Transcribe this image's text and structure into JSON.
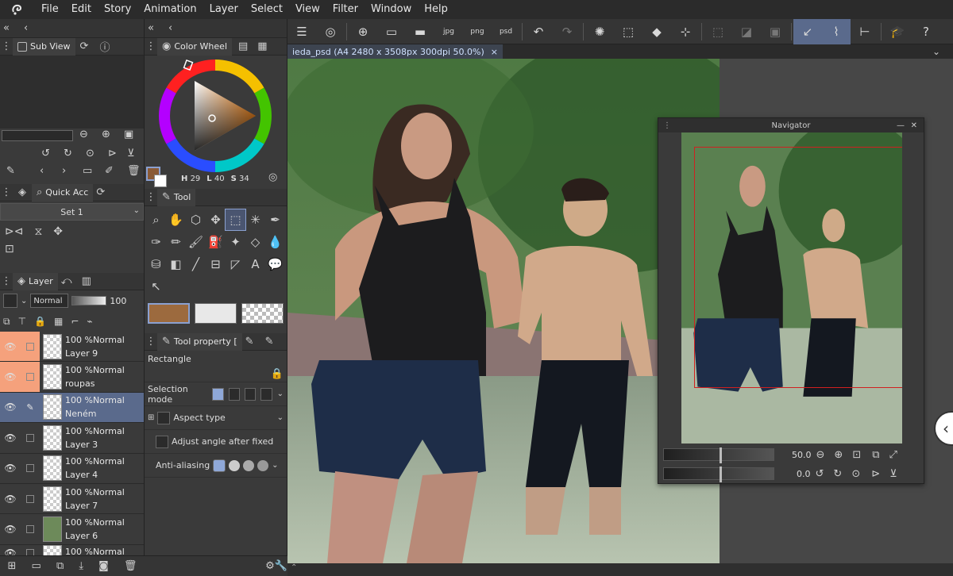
{
  "menu": {
    "items": [
      "File",
      "Edit",
      "Story",
      "Animation",
      "Layer",
      "Select",
      "View",
      "Filter",
      "Window",
      "Help"
    ]
  },
  "subview": {
    "tab_label": "Sub View"
  },
  "quickaccess": {
    "tab_label": "Quick Acc",
    "set_label": "Set 1"
  },
  "colorwheel": {
    "tab_label": "Color Wheel",
    "h_label": "H",
    "h_value": "29",
    "l_label": "L",
    "l_value": "40",
    "s_label": "S",
    "s_value": "34",
    "main_color": "#8a5a36",
    "sub_color": "#ffffff"
  },
  "tool": {
    "tab_label": "Tool"
  },
  "toolproperty": {
    "tab_label": "Tool property [",
    "tool_name": "Rectangle",
    "selection_mode_label": "Selection mode",
    "aspect_type_label": "Aspect type",
    "adjust_angle_label": "Adjust angle after fixed",
    "antialiasing_label": "Anti-aliasing"
  },
  "swatches": {
    "main": "#9c6a3e",
    "sub": "#e8e8e8"
  },
  "layer": {
    "tab_label": "Layer",
    "blend_mode": "Normal",
    "opacity": "100",
    "layers": [
      {
        "opacity": "100 %",
        "mode": "Normal",
        "name": "Layer 9",
        "highlight": true
      },
      {
        "opacity": "100 %",
        "mode": "Normal",
        "name": "roupas",
        "highlight": true
      },
      {
        "opacity": "100 %",
        "mode": "Normal",
        "name": "Neném",
        "selected": true
      },
      {
        "opacity": "100 %",
        "mode": "Normal",
        "name": "Layer 3"
      },
      {
        "opacity": "100 %",
        "mode": "Normal",
        "name": "Layer 4"
      },
      {
        "opacity": "100 %",
        "mode": "Normal",
        "name": "Layer 7"
      },
      {
        "opacity": "100 %",
        "mode": "Normal",
        "name": "Layer 6"
      },
      {
        "opacity": "100 %",
        "mode": "Normal",
        "name": ""
      }
    ]
  },
  "document": {
    "tab_title": "ieda_psd (A4 2480 x 3508px 300dpi 50.0%)"
  },
  "navigator": {
    "title": "Navigator",
    "zoom": "50.0",
    "rotation": "0.0"
  },
  "icons": [
    "clip-studio-logo-icon",
    "menu-icon",
    "new-icon",
    "open-icon",
    "undo-icon",
    "redo-icon",
    "eye-icon",
    "pencil-icon",
    "trash-icon"
  ]
}
